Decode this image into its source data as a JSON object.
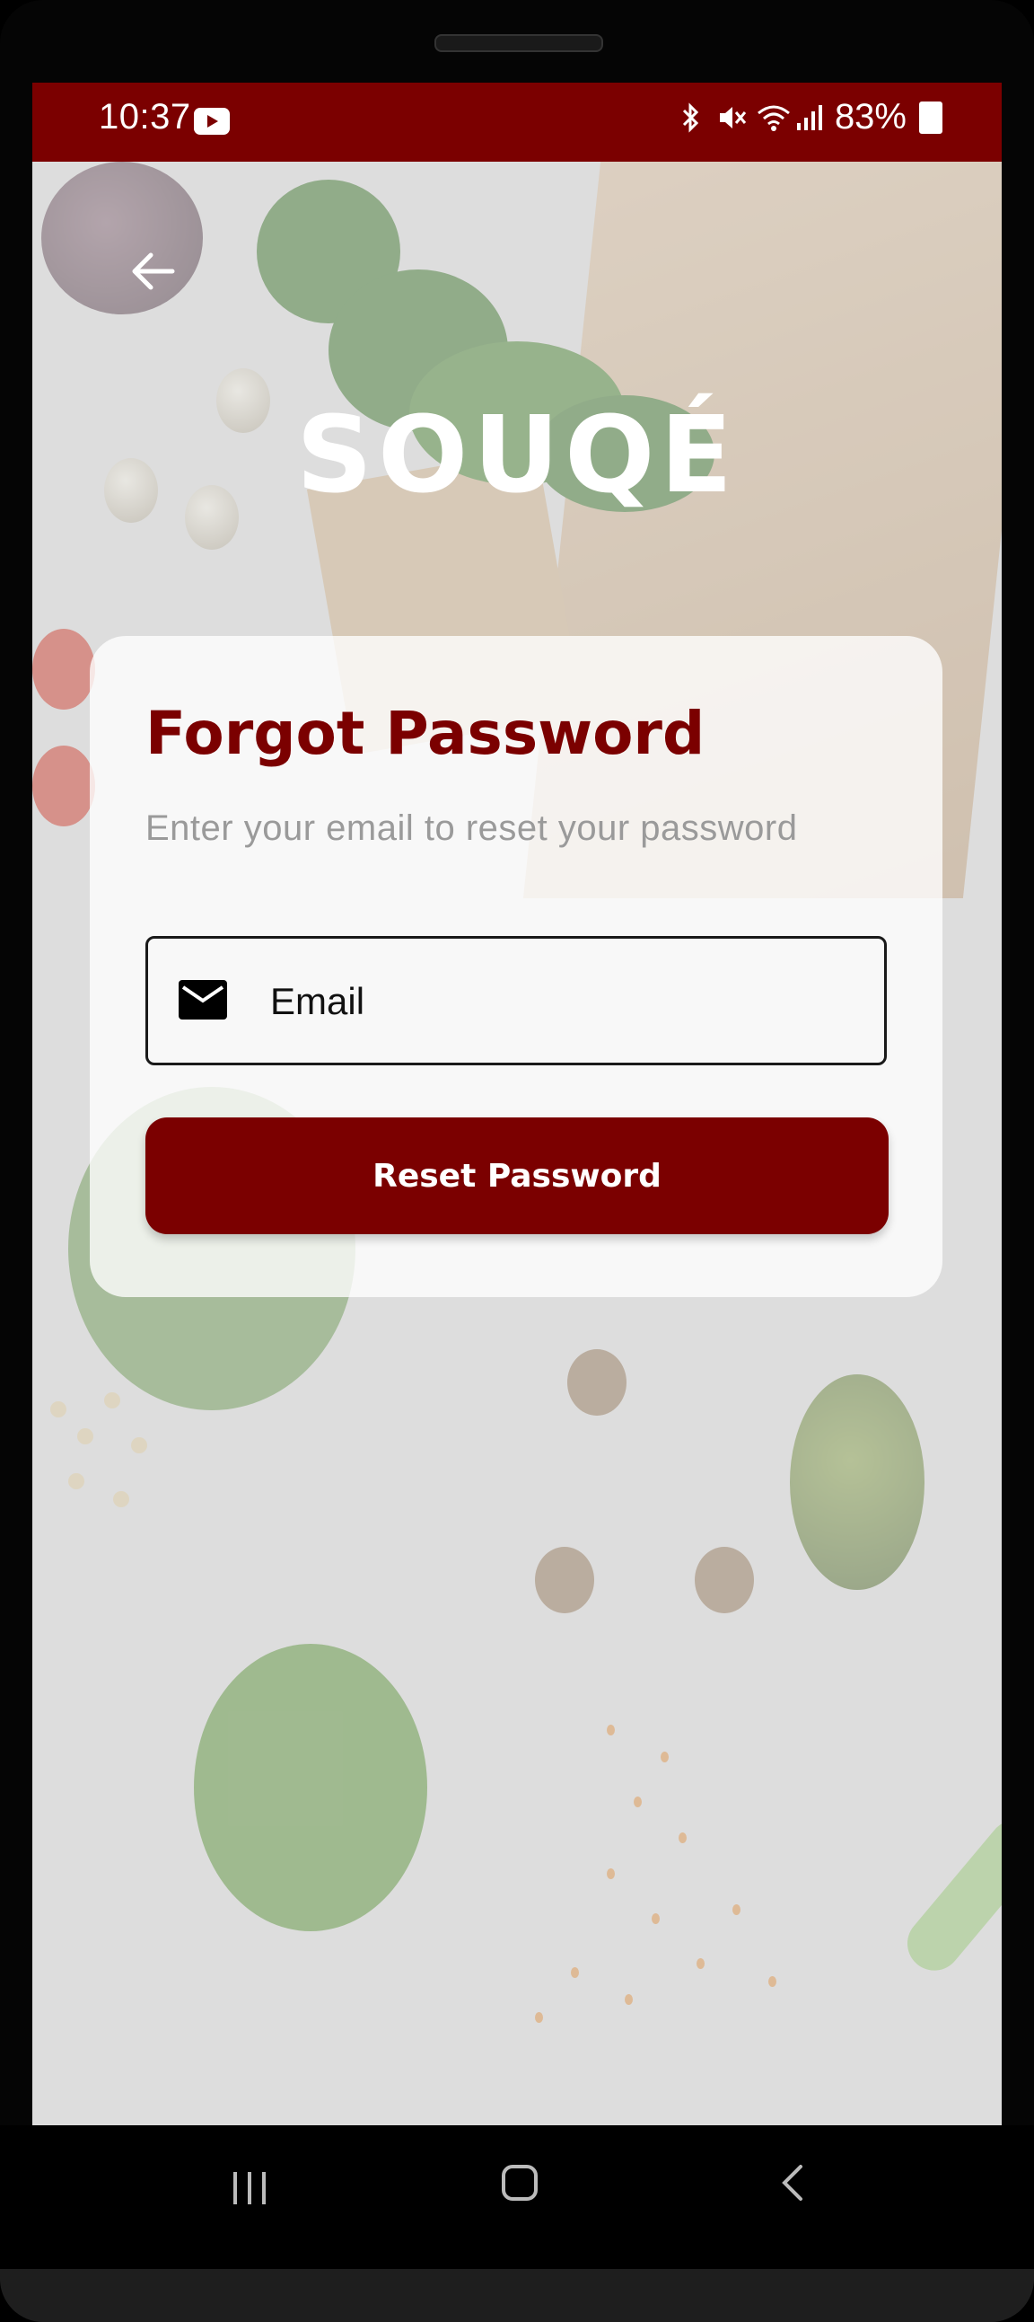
{
  "status_bar": {
    "time": "10:37",
    "battery": "83%",
    "icons": [
      "youtube-icon",
      "bluetooth-icon",
      "mute-icon",
      "wifi-icon",
      "signal-icon",
      "battery-icon"
    ],
    "background_color": "#7b0000"
  },
  "app": {
    "logo_text": "SOUQÉ",
    "accent_color": "#7b0000"
  },
  "card": {
    "title": "Forgot Password",
    "subtitle": "Enter your email to reset your password",
    "email_placeholder": "Email",
    "email_value": "",
    "reset_button_label": "Reset Password"
  },
  "navigation": {
    "icons": [
      "back-arrow-icon",
      "recents-icon",
      "home-icon",
      "back-icon"
    ]
  }
}
